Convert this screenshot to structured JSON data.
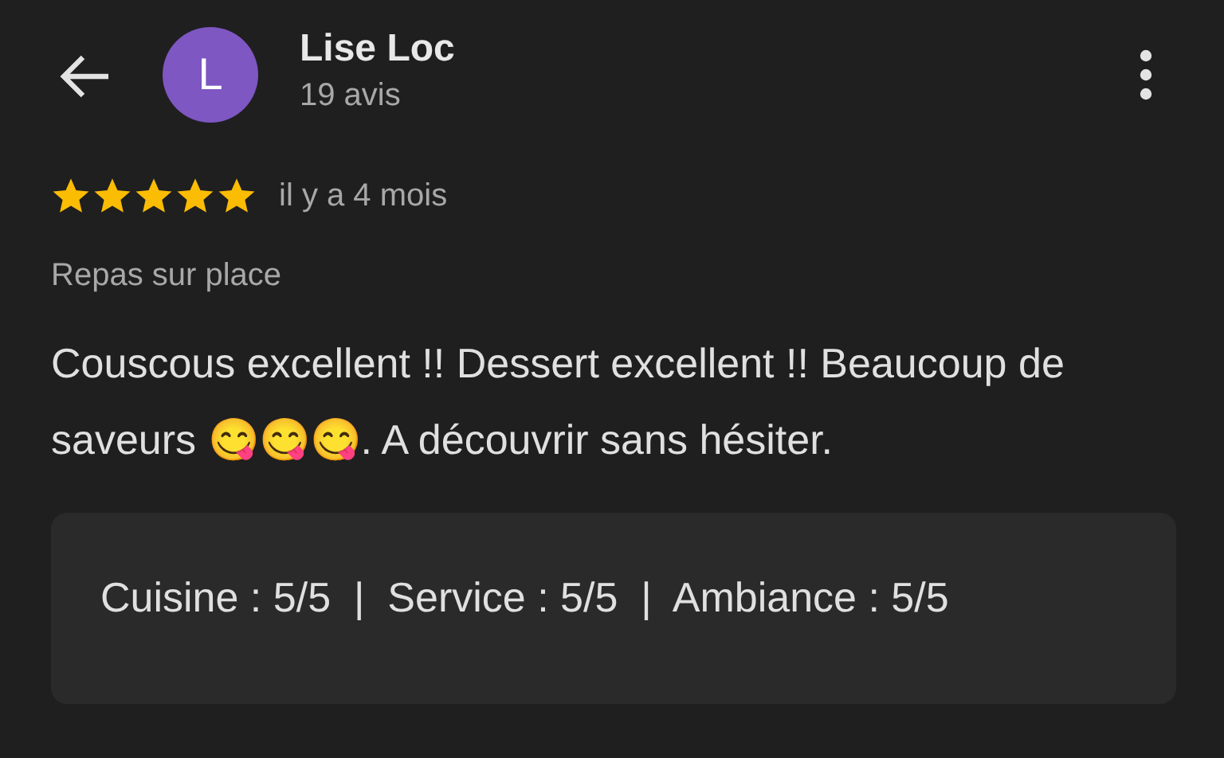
{
  "reviewer": {
    "initial": "L",
    "name": "Lise Loc",
    "count": "19 avis"
  },
  "review": {
    "stars": 5,
    "time": "il y a 4 mois",
    "tag": "Repas sur place",
    "text": "Couscous excellent !! Dessert excellent !! Beaucoup de saveurs 😋😋😋. A découvrir sans hésiter.",
    "ratings": "Cuisine : 5/5  |  Service : 5/5  |  Ambiance : 5/5"
  }
}
